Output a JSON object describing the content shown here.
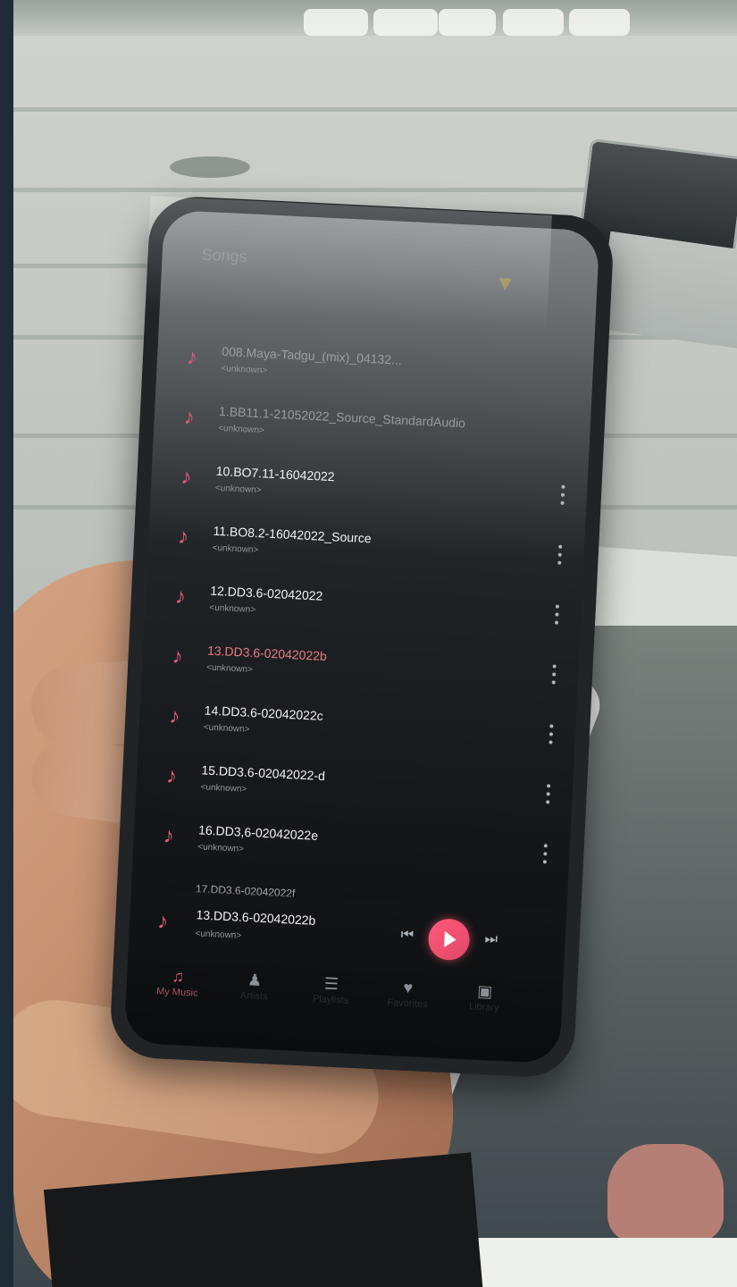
{
  "phone": {
    "header_title": "Songs",
    "tabs_text": "",
    "songs": [
      {
        "title": "008.Maya-Tadgu_(mix)_04132...",
        "subtitle": "<unknown>",
        "state": "faded"
      },
      {
        "title": "1.BB11.1-21052022_Source_StandardAudio",
        "subtitle": "<unknown>",
        "state": "faded"
      },
      {
        "title": "10.BO7.11-16042022",
        "subtitle": "<unknown>",
        "state": "normal"
      },
      {
        "title": "11.BO8.2-16042022_Source",
        "subtitle": "<unknown>",
        "state": "normal"
      },
      {
        "title": "12.DD3.6-02042022",
        "subtitle": "<unknown>",
        "state": "normal"
      },
      {
        "title": "13.DD3.6-02042022b",
        "subtitle": "<unknown>",
        "state": "playing"
      },
      {
        "title": "14.DD3.6-02042022c",
        "subtitle": "<unknown>",
        "state": "normal"
      },
      {
        "title": "15.DD3.6-02042022-d",
        "subtitle": "<unknown>",
        "state": "normal"
      },
      {
        "title": "16.DD3,6-02042022e",
        "subtitle": "<unknown>",
        "state": "normal"
      },
      {
        "title": "17.DD3.6-02042022f",
        "subtitle": "",
        "state": "partial"
      }
    ],
    "now_playing": {
      "title": "13.DD3.6-02042022b",
      "subtitle": "<unknown>"
    },
    "bottom_nav": [
      {
        "label": "My Music",
        "icon": "music-note-icon",
        "state": "active"
      },
      {
        "label": "Artists",
        "icon": "person-music-icon",
        "state": "inactive"
      },
      {
        "label": "Playlists",
        "icon": "playlist-icon",
        "state": "inactive"
      },
      {
        "label": "Favorites",
        "icon": "heart-icon",
        "state": "inactive"
      },
      {
        "label": "Library",
        "icon": "lock-icon",
        "state": "inactive"
      }
    ],
    "accent_color": "#e45c74"
  }
}
